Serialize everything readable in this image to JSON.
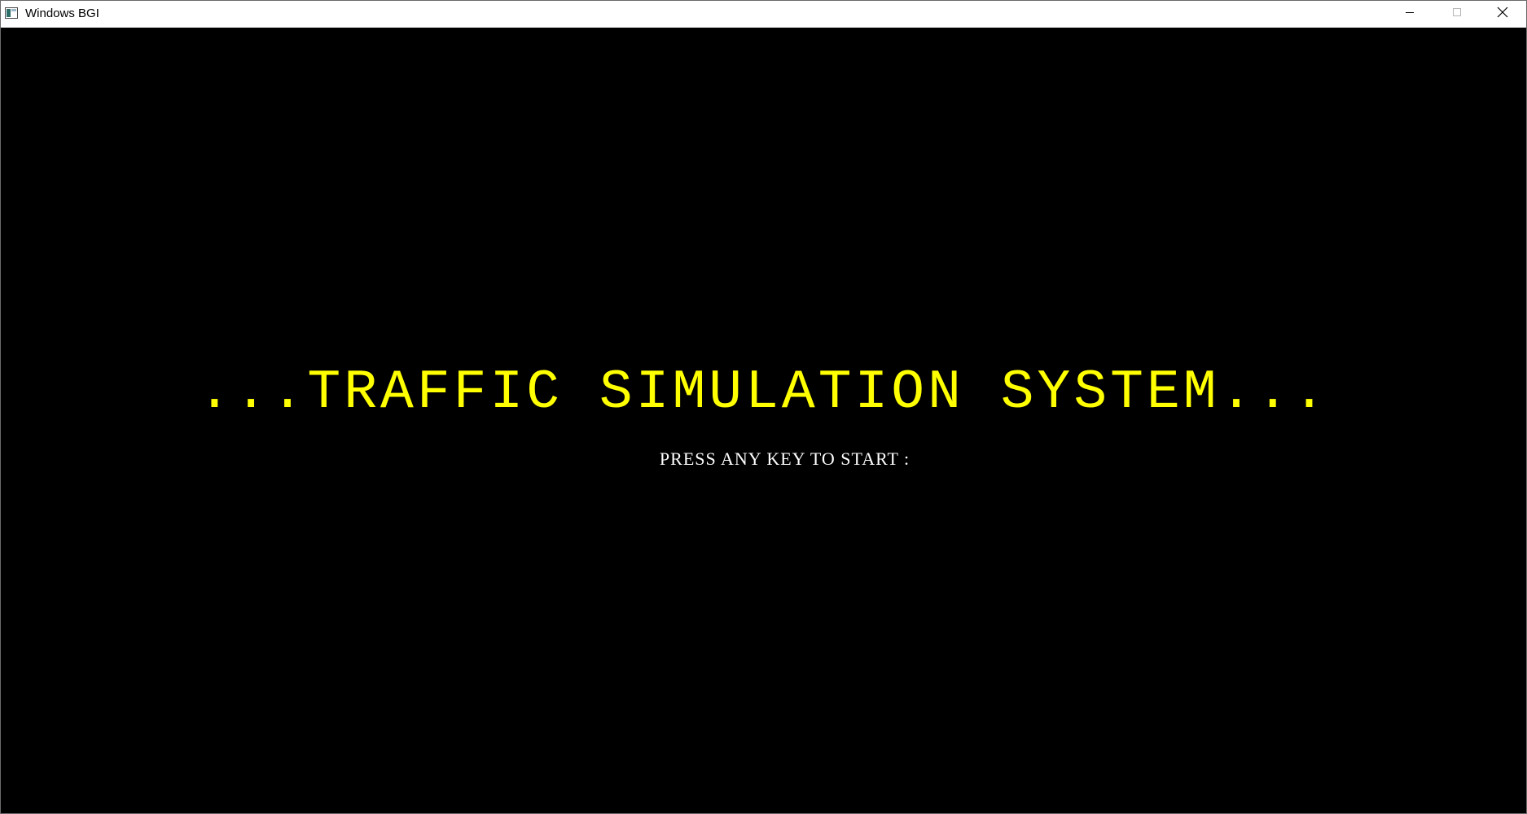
{
  "window": {
    "title": "Windows BGI",
    "app_icon": "bgi-window-icon",
    "controls": {
      "minimize_icon": "minimize-icon",
      "maximize_icon": "maximize-icon",
      "close_icon": "close-icon"
    }
  },
  "screen": {
    "title": "...TRAFFIC SIMULATION SYSTEM...",
    "prompt": "PRESS ANY KEY TO START :",
    "title_color": "#ffff00",
    "prompt_color": "#ffffff",
    "background_color": "#000000"
  }
}
